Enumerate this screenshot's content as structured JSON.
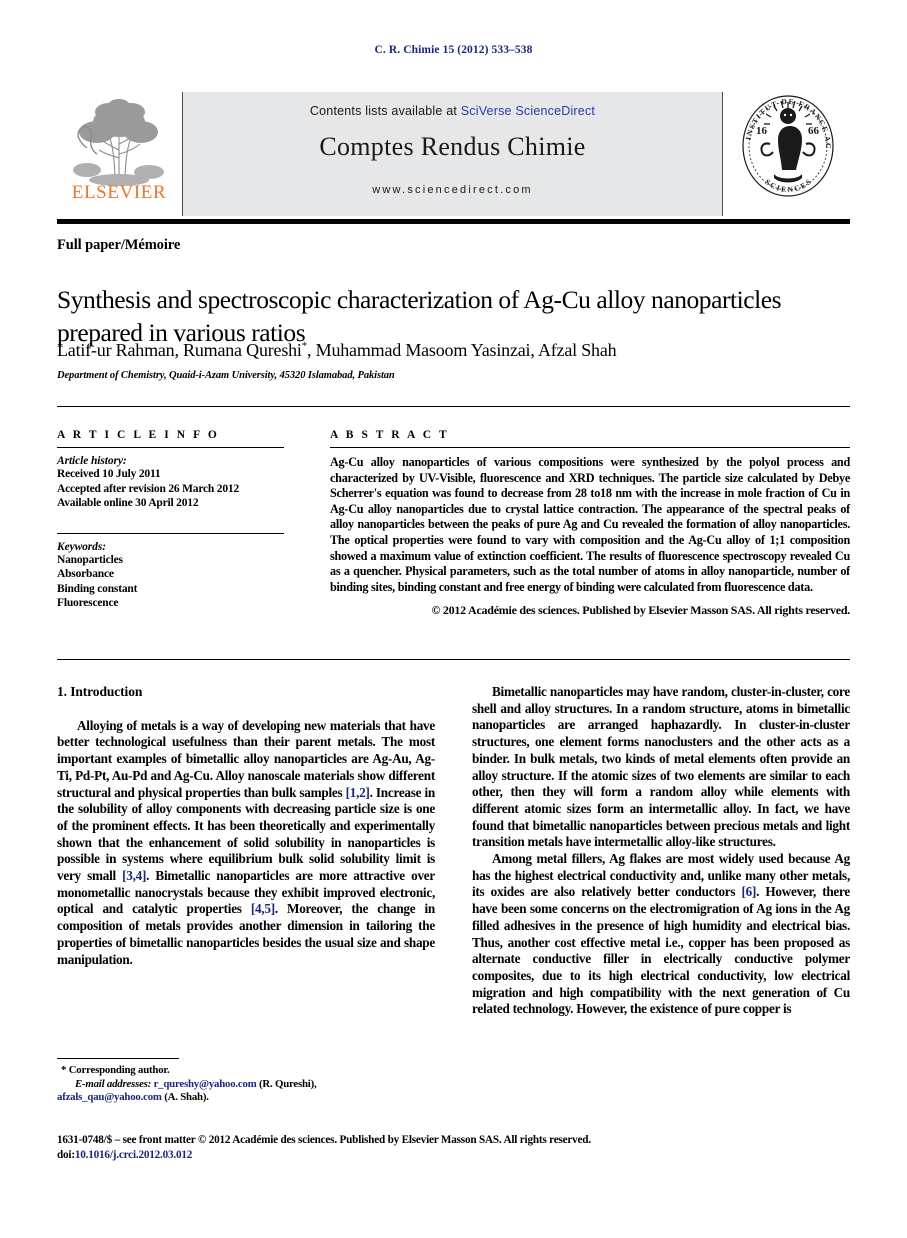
{
  "running_head": "C. R. Chimie 15 (2012) 533–538",
  "masthead": {
    "contents_prefix": "Contents lists available at ",
    "contents_link": "SciVerse ScienceDirect",
    "journal_title": "Comptes Rendus Chimie",
    "url": "www.sciencedirect.com",
    "publisher_wordmark": "ELSEVIER",
    "seal_text_top": "INSTITUT DE FRANCE",
    "seal_text_bottom": "ACADÉMIE DES SCIENCES",
    "seal_year_left": "16",
    "seal_year_right": "66"
  },
  "article": {
    "kind": "Full paper/Mémoire",
    "title": "Synthesis and spectroscopic characterization of Ag-Cu alloy nanoparticles prepared in various ratios",
    "authors": "Latif-ur Rahman, Rumana Qureshi",
    "corresponding_marker": "*",
    "authors_rest": ", Muhammad Masoom Yasinzai, Afzal Shah",
    "affiliation": "Department of Chemistry, Quaid-i-Azam University, 45320 Islamabad, Pakistan"
  },
  "article_info": {
    "heading": "A R T I C L E   I N F O",
    "history_label": "Article history:",
    "history": [
      "Received 10 July 2011",
      "Accepted after revision 26 March 2012",
      "Available online 30 April 2012"
    ],
    "keywords_label": "Keywords:",
    "keywords": [
      "Nanoparticles",
      "Absorbance",
      "Binding constant",
      "Fluorescence"
    ]
  },
  "abstract": {
    "heading": "A B S T R A C T",
    "text": "Ag-Cu alloy nanoparticles of various compositions were synthesized by the polyol process and characterized by UV-Visible, fluorescence and XRD techniques. The particle size calculated by Debye Scherrer's equation was found to decrease from 28 to18 nm with the increase in mole fraction of Cu in Ag-Cu alloy nanoparticles due to crystal lattice contraction. The appearance of the spectral peaks of alloy nanoparticles between the peaks of pure Ag and Cu revealed the formation of alloy nanoparticles. The optical properties were found to vary with composition and the Ag-Cu alloy of 1;1 composition showed a maximum value of extinction coefficient. The results of fluorescence spectroscopy revealed Cu as a quencher. Physical parameters, such as the total number of atoms in alloy nanoparticle, number of binding sites, binding constant and free energy of binding were calculated from fluorescence data.",
    "copyright": "© 2012 Académie des sciences. Published by Elsevier Masson SAS. All rights reserved."
  },
  "body": {
    "section_heading": "1. Introduction",
    "left_paragraph_a": "Alloying of metals is a way of developing new materials that have better technological usefulness than their parent metals. The most important examples of bimetallic alloy nanoparticles are Ag-Au, Ag-Ti, Pd-Pt, Au-Pd and Ag-Cu. Alloy nanoscale materials show different structural and physical properties than bulk samples ",
    "ref_1": "[1,2]",
    "left_paragraph_b": ". Increase in the solubility of alloy components with decreasing particle size is one of the prominent effects. It has been theoretically and experimentally shown that the enhancement of solid solubility in nanoparticles is possible in systems where equilibrium bulk solid solubility limit is very small ",
    "ref_2": "[3,4]",
    "left_paragraph_c": ". Bimetallic nanoparticles are more attractive over monometallic nanocrystals because they exhibit improved electronic, optical and catalytic properties ",
    "ref_3": "[4,5]",
    "left_paragraph_d": ". Moreover, the change in composition of metals provides another dimension in tailoring the properties of bimetallic nanoparticles besides the usual size and shape manipulation.",
    "right_paragraph_a": "Bimetallic nanoparticles may have random, cluster-in-cluster, core shell and alloy structures. In a random structure, atoms in bimetallic nanoparticles are arranged haphazardly. In cluster-in-cluster structures, one element forms nanoclusters and the other acts as a binder. In bulk metals, two kinds of metal elements often provide an alloy structure. If the atomic sizes of two elements are similar to each other, then they will form a random alloy while elements with different atomic sizes form an intermetallic alloy. In fact, we have found that bimetallic nanoparticles between precious metals and light transition metals have intermetallic alloy-like structures.",
    "right_paragraph_b": "Among metal fillers, Ag flakes are most widely used because Ag has the highest electrical conductivity and, unlike many other metals, its oxides are also relatively better conductors ",
    "ref_4": "[6]",
    "right_paragraph_c": ". However, there have been some concerns on the electromigration of Ag ions in the Ag filled adhesives in the presence of high humidity and electrical bias. Thus, another cost effective metal i.e., copper has been proposed as alternate conductive filler in electrically conductive polymer composites, due to its high electrical conductivity, low electrical migration and high compatibility with the next generation of Cu related technology. However, the existence of pure copper is"
  },
  "footnote": {
    "marker": "*",
    "corresponding": "Corresponding author.",
    "email_label": "E-mail addresses:",
    "email_1": "r_qureshy@yahoo.com",
    "email_1_owner": "(R. Qureshi),",
    "email_2": "afzals_qau@yahoo.com",
    "email_2_owner": "(A. Shah)."
  },
  "footer": {
    "issn_line": "1631-0748/$ – see front matter © 2012 Académie des sciences. Published by Elsevier Masson SAS. All rights reserved.",
    "doi_prefix": "doi:",
    "doi": "10.1016/j.crci.2012.03.012"
  },
  "colors": {
    "link_blue": "#17287a",
    "sciencedirect_blue": "#2c39a8",
    "elsevier_orange": "#e8772a",
    "masthead_grey": "#e6e7e9"
  }
}
